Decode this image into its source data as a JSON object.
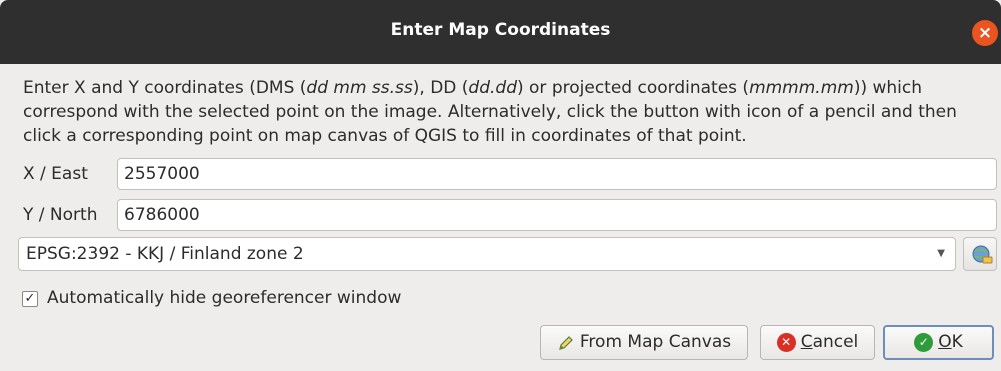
{
  "window": {
    "title": "Enter Map Coordinates",
    "close_icon": "×"
  },
  "description": {
    "part1": "Enter X and Y coordinates (DMS (",
    "dms_format": "dd mm ss.ss",
    "part2": "), DD (",
    "dd_format": "dd.dd",
    "part3": ") or projected coordinates (",
    "proj_format": "mmmm.mm",
    "part4": ")) which correspond with the selected point on the image. Alternatively, click the button with icon of a pencil and then click a corresponding point on map canvas of QGIS to fill in coordinates of that point."
  },
  "x_field": {
    "label": "X / East",
    "value": "2557000"
  },
  "y_field": {
    "label": "Y / North",
    "value": "6786000"
  },
  "crs": {
    "selected": "EPSG:2392 - KKJ / Finland zone 2",
    "icon": "crs-selector-icon"
  },
  "auto_hide": {
    "label": "Automatically hide georeferencer window",
    "checked": true,
    "mark": "✓"
  },
  "buttons": {
    "from_map_canvas": "From Map Canvas",
    "cancel_first": "C",
    "cancel_rest": "ancel",
    "ok_first": "O",
    "ok_rest": "K"
  },
  "colors": {
    "titlebar": "#2f2f2f",
    "close": "#e95420",
    "cancel_icon": "#d93025",
    "ok_icon": "#2e9c3a"
  }
}
